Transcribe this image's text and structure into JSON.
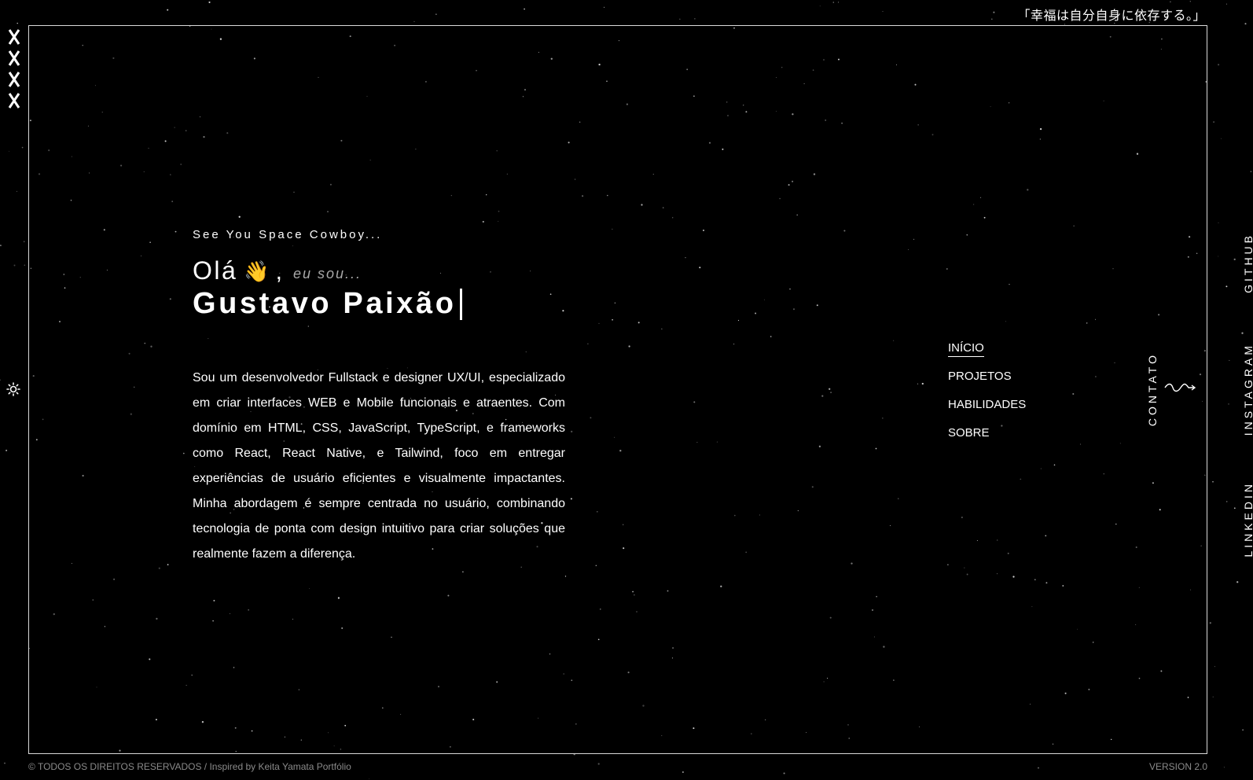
{
  "header": {
    "quote": "「幸福は自分自身に依存する。」"
  },
  "sidebar": {
    "marks": [
      "X",
      "X",
      "X",
      "X"
    ],
    "theme_icon": "sun-icon"
  },
  "hero": {
    "tagline": "See You Space Cowboy...",
    "greeting": "Olá",
    "wave_emoji": "👋",
    "comma": ",",
    "intro": "eu sou...",
    "name": "Gustavo Paixão",
    "bio": "Sou um desenvolvedor Fullstack e designer UX/UI, especializado em criar interfaces WEB e Mobile funcionais e atraentes. Com domínio em HTML, CSS, JavaScript, TypeScript, e frameworks como React, React Native, e Tailwind, foco em entregar experiências de usuário eficientes e visualmente impactantes. Minha abordagem é sempre centrada no usuário, combinando tecnologia de ponta com design intuitivo para criar soluções que realmente fazem a diferença."
  },
  "nav": {
    "items": [
      {
        "label": "INÍCIO",
        "active": true
      },
      {
        "label": "PROJETOS",
        "active": false
      },
      {
        "label": "HABILIDADES",
        "active": false
      },
      {
        "label": "SOBRE",
        "active": false
      }
    ]
  },
  "contact": {
    "label": "CONTATO"
  },
  "social": {
    "github": "GITHUB",
    "instagram": "INSTAGRAM",
    "linkedin": "LINKEDIN"
  },
  "footer": {
    "left": "© TODOS OS DIREITOS RESERVADOS / Inspired by Keita Yamata Portfólio",
    "right": "VERSION 2.0"
  },
  "colors": {
    "background": "#000000",
    "text": "#ffffff",
    "muted": "#8a8a8a",
    "frame": "#d9d9d9"
  }
}
